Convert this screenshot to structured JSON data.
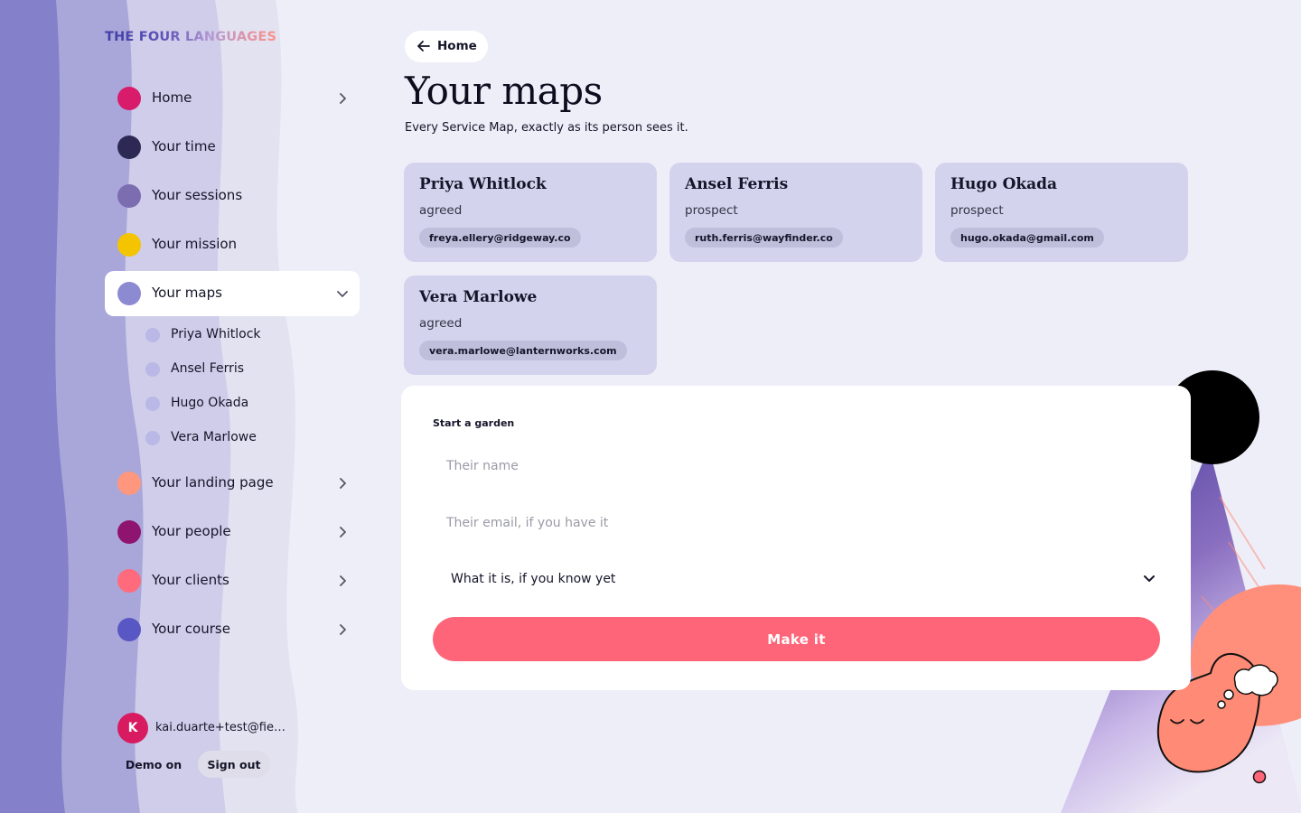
{
  "brand": {
    "name": "THE FOUR LANGUAGES"
  },
  "colors": {
    "accent": "#ff6579",
    "panel": "#ffffff",
    "card": "#d3d3ee",
    "background": "#eeeef8"
  },
  "sidebar": {
    "items": [
      {
        "label": "Home",
        "dot": "#d81b6a",
        "chevron": "right"
      },
      {
        "label": "Your time",
        "dot": "#2c2a55",
        "chevron": ""
      },
      {
        "label": "Your sessions",
        "dot": "#7b6db0",
        "chevron": ""
      },
      {
        "label": "Your mission",
        "dot": "#f5c400",
        "chevron": ""
      },
      {
        "label": "Your maps",
        "dot": "#8c8ad0",
        "chevron": "down",
        "active": true
      },
      {
        "label": "Your landing page",
        "dot": "#ff967e",
        "chevron": "right"
      },
      {
        "label": "Your people",
        "dot": "#8e1470",
        "chevron": "right"
      },
      {
        "label": "Your clients",
        "dot": "#ff6b7d",
        "chevron": "right"
      },
      {
        "label": "Your course",
        "dot": "#5857c4",
        "chevron": "right"
      }
    ],
    "sub_items": [
      {
        "label": "Priya Whitlock"
      },
      {
        "label": "Ansel Ferris"
      },
      {
        "label": "Hugo Okada"
      },
      {
        "label": "Vera Marlowe"
      }
    ]
  },
  "account": {
    "avatar_letter": "K",
    "email": "kai.duarte+test@fiel...",
    "demo_label": "Demo on",
    "signout_label": "Sign out"
  },
  "header": {
    "back_label": "Home",
    "title": "Your maps",
    "subtitle": "Every Service Map, exactly as its person sees it."
  },
  "maps": [
    {
      "name": "Priya Whitlock",
      "status": "agreed",
      "email": "freya.ellery@ridgeway.co"
    },
    {
      "name": "Ansel Ferris",
      "status": "prospect",
      "email": "ruth.ferris@wayfinder.co"
    },
    {
      "name": "Hugo Okada",
      "status": "prospect",
      "email": "hugo.okada@gmail.com"
    },
    {
      "name": "Vera Marlowe",
      "status": "agreed",
      "email": "vera.marlowe@lanternworks.com"
    }
  ],
  "form": {
    "heading": "Start a garden",
    "name_placeholder": "Their name",
    "email_placeholder": "Their email, if you have it",
    "type_value": "What it is, if you know yet",
    "submit_label": "Make it"
  }
}
